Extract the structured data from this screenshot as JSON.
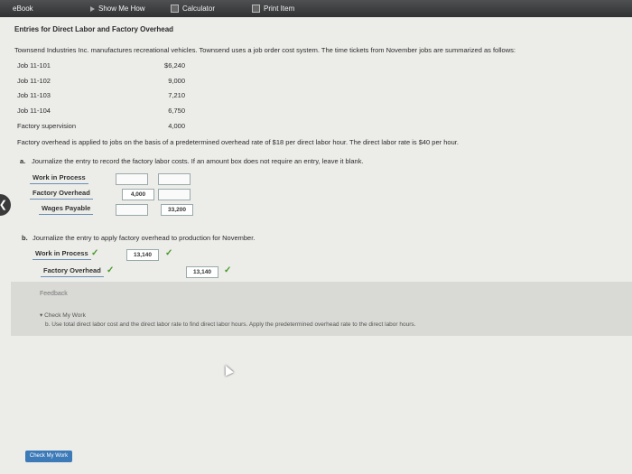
{
  "toolbar": {
    "ebook": "eBook",
    "show_me_how": "Show Me How",
    "calculator": "Calculator",
    "print_item": "Print Item"
  },
  "content": {
    "title": "Entries for Direct Labor and Factory Overhead",
    "intro": "Townsend Industries Inc. manufactures recreational vehicles. Townsend uses a job order cost system. The time tickets from November jobs are summarized as follows:",
    "jobs": [
      {
        "label": "Job 11-101",
        "amount": "$6,240"
      },
      {
        "label": "Job 11-102",
        "amount": "9,000"
      },
      {
        "label": "Job 11-103",
        "amount": "7,210"
      },
      {
        "label": "Job 11-104",
        "amount": "6,750"
      },
      {
        "label": "Factory supervision",
        "amount": "4,000"
      }
    ],
    "overhead_note": "Factory overhead is applied to jobs on the basis of a predetermined overhead rate of $18 per direct labor hour. The direct labor rate is $40 per hour."
  },
  "part_a": {
    "label": "a.",
    "question": "Journalize the entry to record the factory labor costs. If an amount box does not require an entry, leave it blank.",
    "rows": [
      {
        "account": "Work in Process",
        "debit": "",
        "credit": ""
      },
      {
        "account": "Factory Overhead",
        "debit": "4,000",
        "credit": ""
      },
      {
        "account": "Wages Payable",
        "debit": "",
        "credit": "33,200"
      }
    ]
  },
  "part_b": {
    "label": "b.",
    "question": "Journalize the entry to apply factory overhead to production for November.",
    "rows": [
      {
        "account": "Work in Process",
        "debit": "13,140",
        "credit": ""
      },
      {
        "account": "Factory Overhead",
        "debit": "",
        "credit": "13,140"
      }
    ]
  },
  "feedback": {
    "heading": "Feedback",
    "check_label": "Check My Work",
    "hint": "b. Use total direct labor cost and the direct labor rate to find direct labor hours. Apply the predetermined overhead rate to the direct labor hours."
  },
  "footer": {
    "check_button": "Check My Work"
  }
}
